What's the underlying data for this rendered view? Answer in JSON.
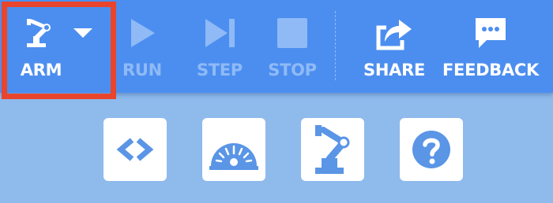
{
  "toolbar": {
    "arm": {
      "label": "ARM",
      "icon": "robot-arm-icon",
      "dropdown_icon": "caret-down-icon",
      "selected": true
    },
    "run": {
      "label": "RUN",
      "icon": "play-icon",
      "enabled": false
    },
    "step": {
      "label": "STEP",
      "icon": "step-forward-icon",
      "enabled": false
    },
    "stop": {
      "label": "STOP",
      "icon": "stop-icon",
      "enabled": false
    },
    "share": {
      "label": "SHARE",
      "icon": "share-icon",
      "enabled": true
    },
    "feedback": {
      "label": "FEEDBACK",
      "icon": "feedback-icon",
      "enabled": true
    }
  },
  "tiles": [
    {
      "name": "code",
      "icon": "code-icon"
    },
    {
      "name": "dashboard",
      "icon": "gauge-icon"
    },
    {
      "name": "arm",
      "icon": "robot-arm-icon"
    },
    {
      "name": "help",
      "icon": "help-icon"
    }
  ],
  "colors": {
    "toolbar": "#4c8ef0",
    "background": "#8fbaec",
    "selection": "#e8452c",
    "disabled": "#8fbaf6",
    "icon_fill": "#5a95e6"
  }
}
